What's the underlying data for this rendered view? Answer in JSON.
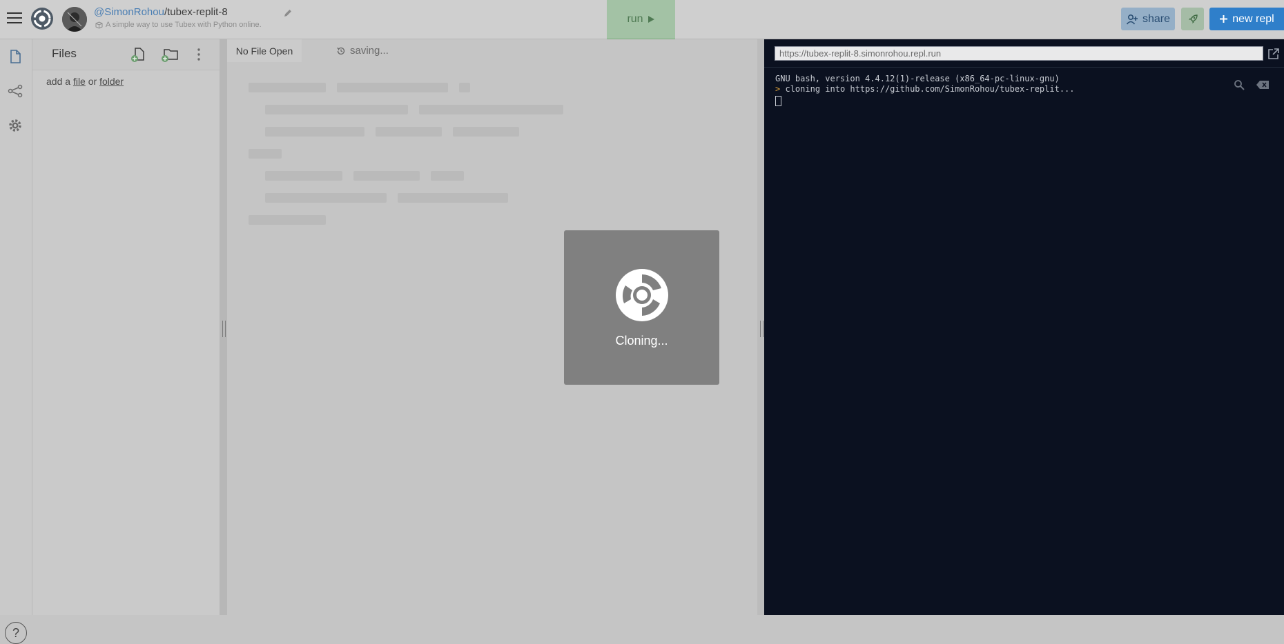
{
  "header": {
    "repo_owner": "@SimonRohou",
    "repo_sep": "/",
    "repo_name": "tubex-replit-8",
    "repo_description": "A simple way to use Tubex with Python online.",
    "run_label": "run",
    "share_label": "share",
    "new_repl_label": "new repl"
  },
  "files": {
    "title": "Files",
    "hint_prefix": "add a ",
    "hint_file": "file",
    "hint_or": " or ",
    "hint_folder": "folder"
  },
  "editor": {
    "tab_label": "No File Open",
    "saving_label": "saving..."
  },
  "overlay": {
    "status": "Cloning..."
  },
  "terminal": {
    "url": "https://tubex-replit-8.simonrohou.repl.run",
    "lines": [
      "GNU bash, version 4.4.12(1)-release (x86_64-pc-linux-gnu)",
      "cloning into https://github.com/SimonRohou/tubex-replit..."
    ],
    "prompt_symbol": ">"
  },
  "help": {
    "label": "?"
  },
  "colors": {
    "accent": "#2f7fca",
    "terminal_bg": "#0b1120",
    "run_green": "#79a97c"
  }
}
